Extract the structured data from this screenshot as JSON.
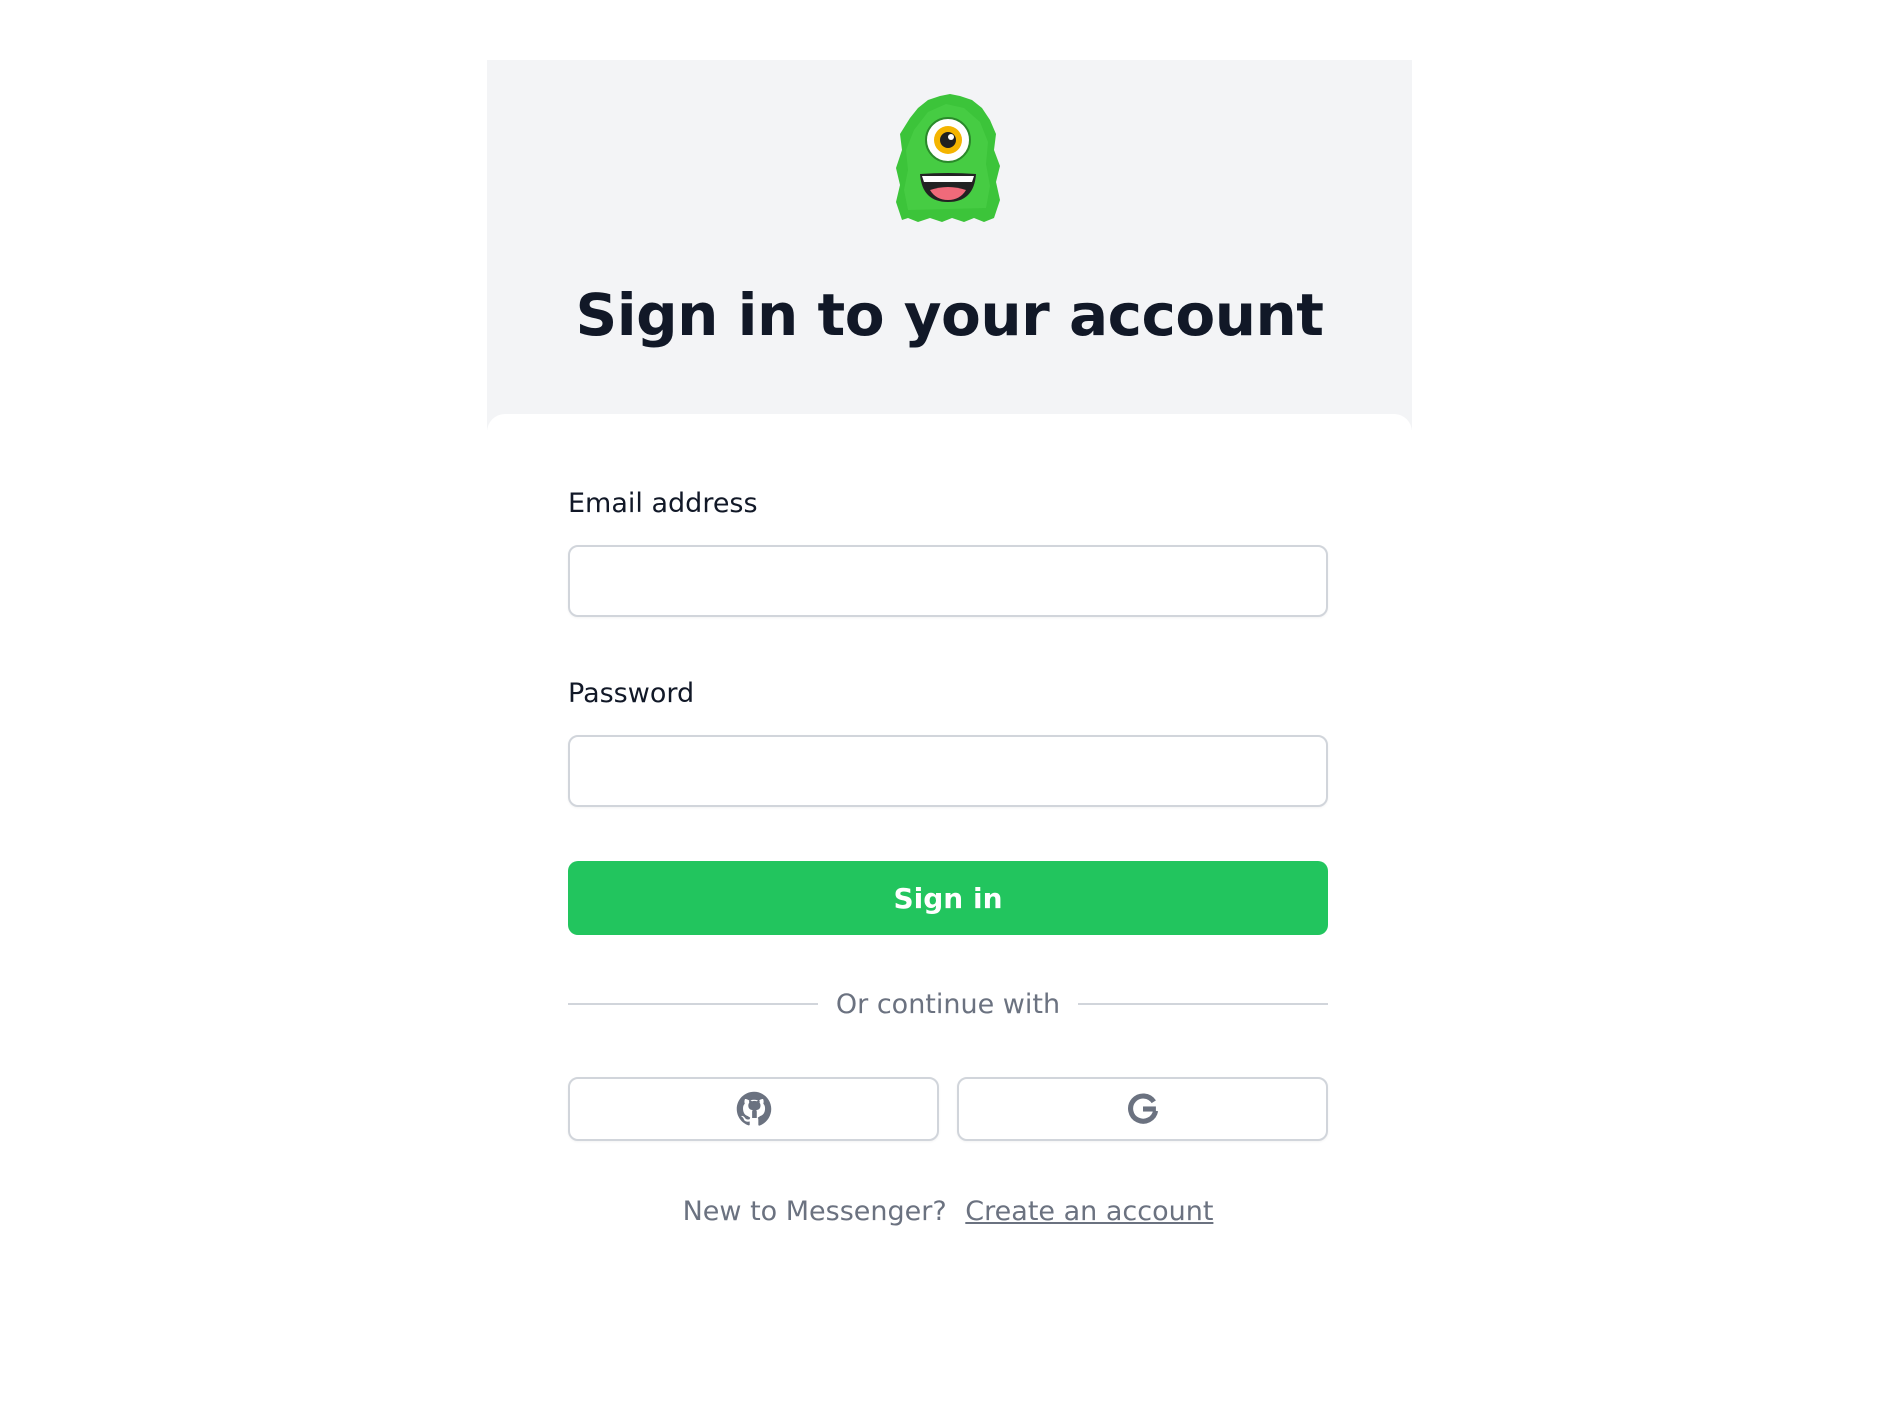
{
  "header": {
    "title": "Sign in to your account"
  },
  "form": {
    "email_label": "Email address",
    "email_value": "",
    "email_placeholder": "",
    "password_label": "Password",
    "password_value": "",
    "password_placeholder": "",
    "signin_label": "Sign in"
  },
  "divider": {
    "text": "Or continue with"
  },
  "social": {
    "github_icon": "github-icon",
    "google_icon": "google-icon"
  },
  "footer": {
    "prompt": "New to Messenger?",
    "link_label": "Create an account"
  },
  "colors": {
    "accent": "#22c55e",
    "header_bg": "#f3f4f6",
    "text_dark": "#111827",
    "text_muted": "#6b7280",
    "border": "#d1d5db",
    "logo_green": "#3cc43a"
  }
}
